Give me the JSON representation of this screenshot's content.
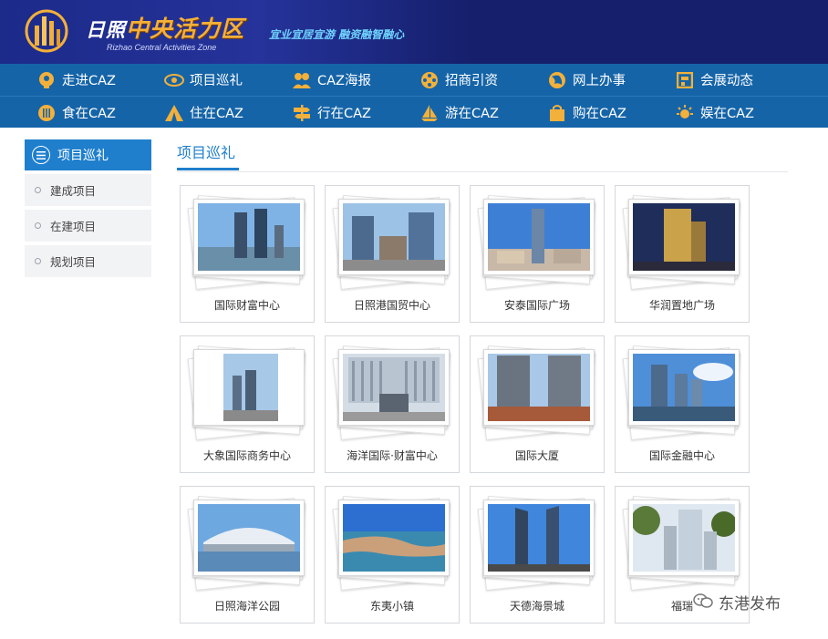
{
  "header": {
    "brand_prefix": "日照",
    "brand_main": "中央活力区",
    "brand_en": "Rizhao Central Activities Zone",
    "slogan": "宜业宜居宜游 融资融智融心",
    "bg_color": "#151f6b",
    "brand_color": "#f3b03a"
  },
  "nav": {
    "bg_color": "#1564a8",
    "row1": [
      {
        "label": "走进CAZ",
        "icon": "head-icon"
      },
      {
        "label": "项目巡礼",
        "icon": "eye-icon"
      },
      {
        "label": "CAZ海报",
        "icon": "people-icon"
      },
      {
        "label": "招商引资",
        "icon": "film-reel-icon"
      },
      {
        "label": "网上办事",
        "icon": "globe-icon"
      },
      {
        "label": "会展动态",
        "icon": "layout-icon"
      }
    ],
    "row2": [
      {
        "label": "食在CAZ",
        "icon": "dining-icon"
      },
      {
        "label": "住在CAZ",
        "icon": "tent-icon"
      },
      {
        "label": "行在CAZ",
        "icon": "signpost-icon"
      },
      {
        "label": "游在CAZ",
        "icon": "sailboat-icon"
      },
      {
        "label": "购在CAZ",
        "icon": "shopping-bag-icon"
      },
      {
        "label": "娱在CAZ",
        "icon": "sun-icon"
      }
    ]
  },
  "sidebar": {
    "heading": "项目巡礼",
    "items": [
      {
        "label": "建成项目"
      },
      {
        "label": "在建项目"
      },
      {
        "label": "规划项目"
      }
    ]
  },
  "main": {
    "title": "项目巡礼",
    "accent_color": "#1f7fcd",
    "projects": [
      {
        "name": "国际财富中心"
      },
      {
        "name": "日照港国贸中心"
      },
      {
        "name": "安泰国际广场"
      },
      {
        "name": "华润置地广场"
      },
      {
        "name": "大象国际商务中心"
      },
      {
        "name": "海洋国际·财富中心"
      },
      {
        "name": "国际大厦"
      },
      {
        "name": "国际金融中心"
      },
      {
        "name": "日照海洋公园"
      },
      {
        "name": "东夷小镇"
      },
      {
        "name": "天德海景城"
      },
      {
        "name": "福瑞"
      }
    ]
  },
  "watermark": {
    "label": "东港发布",
    "icon": "wechat-icon"
  }
}
